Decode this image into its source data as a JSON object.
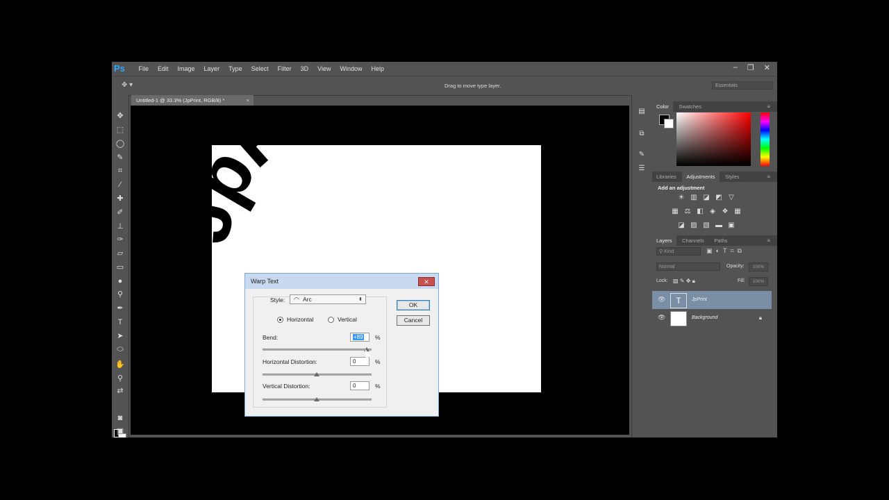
{
  "app": {
    "logo": "Ps",
    "menu": [
      "File",
      "Edit",
      "Image",
      "Layer",
      "Type",
      "Select",
      "Filter",
      "3D",
      "View",
      "Window",
      "Help"
    ],
    "window_controls": {
      "minimize": "–",
      "restore": "❐",
      "close": "✕"
    }
  },
  "options_bar": {
    "hint": "Drag to move type layer.",
    "workspace": "Essentials"
  },
  "document": {
    "tab_title": "Untitled-1 @ 33.3% (JpPrint, RGB/8) *",
    "tab_close": "×",
    "warped_text": "JpPrint"
  },
  "panels": {
    "color_tabs": [
      "Color",
      "Swatches"
    ],
    "adjust_tabs": [
      "Libraries",
      "Adjustments",
      "Styles"
    ],
    "adjust_title": "Add an adjustment",
    "layers_tabs": [
      "Layers",
      "Channels",
      "Paths"
    ],
    "layer_find": "Kind",
    "blend_mode": "Normal",
    "opacity_label": "Opacity:",
    "opacity_value": "100%",
    "lock_label": "Lock:",
    "fill_label": "Fill:",
    "fill_value": "100%",
    "layers": [
      {
        "name": "JpPrint",
        "thumb": "T",
        "selected": true
      },
      {
        "name": "Background",
        "thumb": "",
        "selected": false,
        "locked": true
      }
    ]
  },
  "dialog": {
    "title": "Warp Text",
    "close": "✕",
    "style_label": "Style:",
    "style_value": "Arc",
    "orientation": {
      "horizontal": "Horizontal",
      "vertical": "Vertical",
      "selected": "Horizontal"
    },
    "bend_label": "Bend:",
    "bend_value": "+89",
    "hdist_label": "Horizontal Distortion:",
    "hdist_value": "0",
    "vdist_label": "Vertical Distortion:",
    "vdist_value": "0",
    "percent": "%",
    "ok": "OK",
    "cancel": "Cancel"
  },
  "colors": {
    "accent_blue": "#31a8ff",
    "selected_layer": "#7a8ea6",
    "dialog_close": "#c75050"
  }
}
